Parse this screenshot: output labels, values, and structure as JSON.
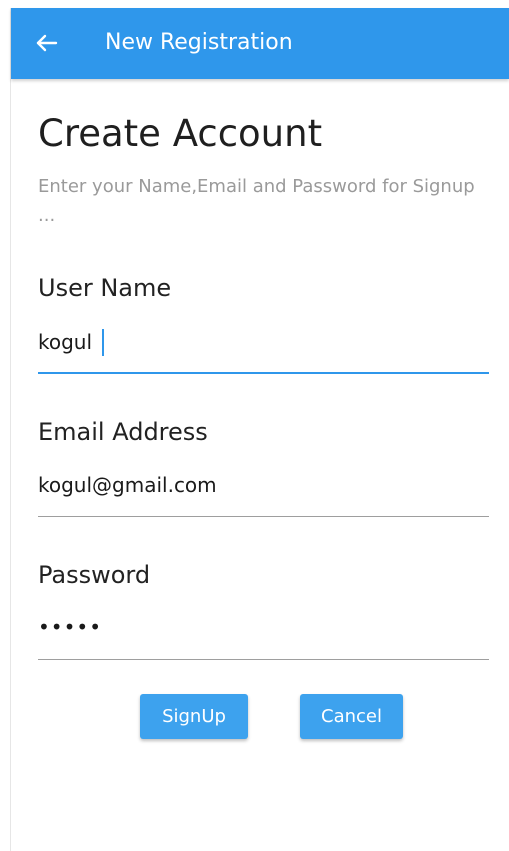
{
  "appbar": {
    "title": "New Registration",
    "back_icon": "arrow-left-icon",
    "color": "#2f97eb"
  },
  "header": {
    "title": "Create Account",
    "subtitle": "Enter your Name,Email and Password for Signup ..."
  },
  "form": {
    "username": {
      "label": "User Name",
      "value": "kogul"
    },
    "email": {
      "label": "Email Address",
      "value": "kogul@gmail.com"
    },
    "password": {
      "label": "Password",
      "value": "•••••"
    }
  },
  "actions": {
    "signup_label": "SignUp",
    "cancel_label": "Cancel",
    "button_color": "#3da2ee"
  }
}
